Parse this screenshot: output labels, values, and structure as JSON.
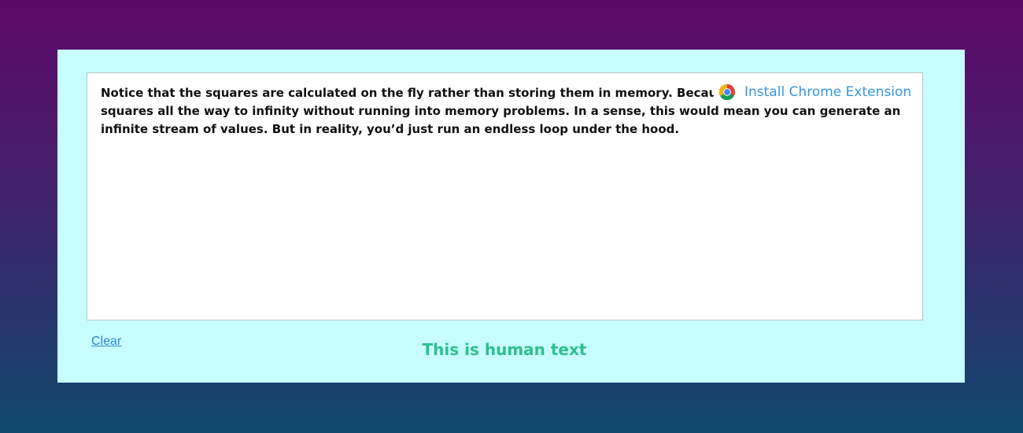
{
  "editor": {
    "text": "Notice that the squares are calculated on the fly rather than storing them in memory. Because of this, you can generate squares all the way to infinity without running into memory problems. In a sense, this would mean you can generate an infinite stream of values. But in reality, you’d just run an endless loop under the hood."
  },
  "extension": {
    "icon": "chrome-icon",
    "label": "Install Chrome Extension"
  },
  "actions": {
    "clear_label": "Clear"
  },
  "result": {
    "label": "This is human text"
  },
  "colors": {
    "panel_bg": "#c8fdfd",
    "link": "#2f86d8",
    "extension_text": "#3796e0",
    "result_text": "#2ebf8f"
  }
}
